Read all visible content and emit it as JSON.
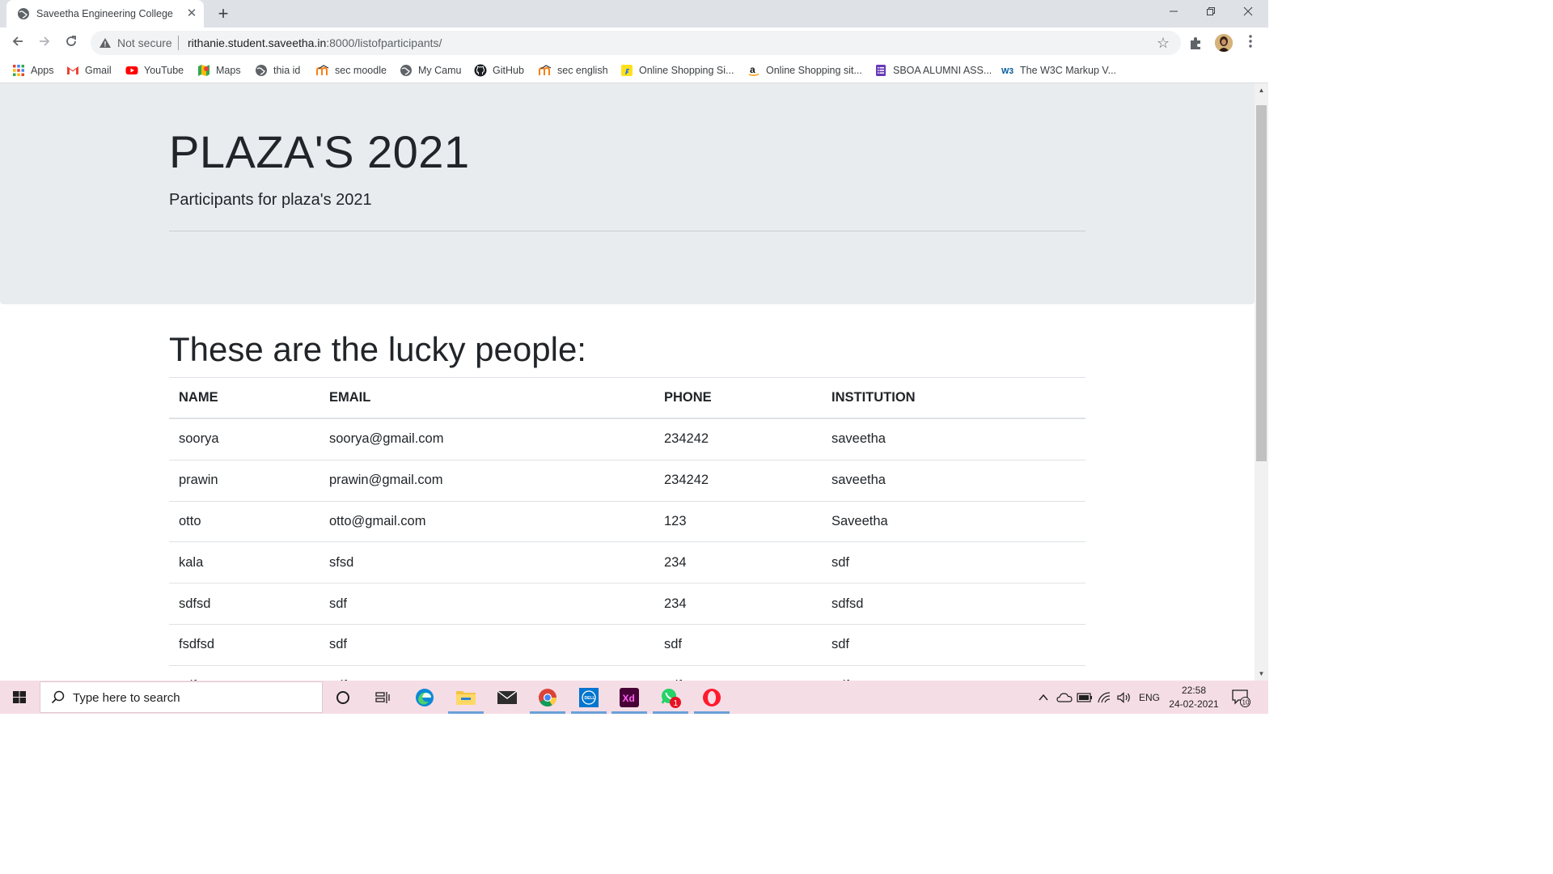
{
  "browser": {
    "tab_title": "Saveetha Engineering College",
    "tab_close": "✕",
    "new_tab": "+",
    "security_label": "Not secure",
    "url_host": "rithanie.student.saveetha.in",
    "url_path": ":8000/listofparticipants/"
  },
  "bookmarks": [
    {
      "label": "Apps",
      "icon": "apps-grid-icon"
    },
    {
      "label": "Gmail",
      "icon": "gmail-icon"
    },
    {
      "label": "YouTube",
      "icon": "youtube-icon"
    },
    {
      "label": "Maps",
      "icon": "maps-icon"
    },
    {
      "label": "thia id",
      "icon": "globe-icon"
    },
    {
      "label": "sec moodle",
      "icon": "moodle-icon"
    },
    {
      "label": "My Camu",
      "icon": "globe-icon"
    },
    {
      "label": "GitHub",
      "icon": "github-icon"
    },
    {
      "label": "sec english",
      "icon": "moodle-icon"
    },
    {
      "label": "Online Shopping Si...",
      "icon": "flipkart-icon"
    },
    {
      "label": "Online Shopping sit...",
      "icon": "amazon-icon"
    },
    {
      "label": "SBOA ALUMNI ASS...",
      "icon": "form-icon"
    },
    {
      "label": "The W3C Markup V...",
      "icon": "w3c-icon"
    }
  ],
  "page": {
    "title": "PLAZA'S 2021",
    "lead": "Participants for plaza's 2021",
    "section_title": "These are the lucky people:",
    "table": {
      "headers": [
        "NAME",
        "EMAIL",
        "PHONE",
        "INSTITUTION"
      ],
      "rows": [
        [
          "soorya",
          "soorya@gmail.com",
          "234242",
          "saveetha"
        ],
        [
          "prawin",
          "prawin@gmail.com",
          "234242",
          "saveetha"
        ],
        [
          "otto",
          "otto@gmail.com",
          "123",
          "Saveetha"
        ],
        [
          "kala",
          "sfsd",
          "234",
          "sdf"
        ],
        [
          "sdfsd",
          "sdf",
          "234",
          "sdfsd"
        ],
        [
          "fsdfsd",
          "sdf",
          "sdf",
          "sdf"
        ],
        [
          "sdf",
          "sdf",
          "sdf",
          "sdf"
        ]
      ]
    }
  },
  "taskbar": {
    "search_placeholder": "Type here to search",
    "language": "ENG",
    "time": "22:58",
    "date": "24-02-2021",
    "whatsapp_badge": "1",
    "notification_count": "10"
  }
}
